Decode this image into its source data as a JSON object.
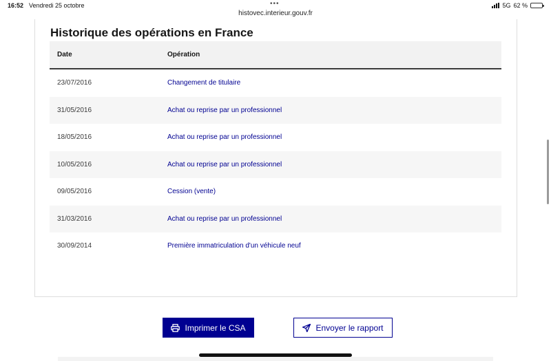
{
  "statusbar": {
    "time": "16:52",
    "date": "Vendredi 25 octobre",
    "dots": "•••",
    "network": "5G",
    "battery": "62 %",
    "battery_level_pct": 62
  },
  "browser": {
    "url": "histovec.interieur.gouv.fr"
  },
  "section": {
    "title": "Historique des opérations en France"
  },
  "table": {
    "headers": {
      "date": "Date",
      "operation": "Opération"
    },
    "rows": [
      {
        "date": "23/07/2016",
        "operation": "Changement de titulaire"
      },
      {
        "date": "31/05/2016",
        "operation": "Achat ou reprise par un professionnel"
      },
      {
        "date": "18/05/2016",
        "operation": "Achat ou reprise par un professionnel"
      },
      {
        "date": "10/05/2016",
        "operation": "Achat ou reprise par un professionnel"
      },
      {
        "date": "09/05/2016",
        "operation": "Cession (vente)"
      },
      {
        "date": "31/03/2016",
        "operation": "Achat ou reprise par un professionnel"
      },
      {
        "date": "30/09/2014",
        "operation": "Première immatriculation d'un véhicule neuf"
      }
    ]
  },
  "actions": {
    "print_label": "Imprimer le CSA",
    "send_label": "Envoyer le rapport"
  },
  "icons": {
    "print": "printer-icon",
    "send": "paper-plane-icon"
  },
  "colors": {
    "primary": "#000091",
    "header_bg": "#f2f2f2",
    "row_alt_bg": "#f6f6f6"
  }
}
